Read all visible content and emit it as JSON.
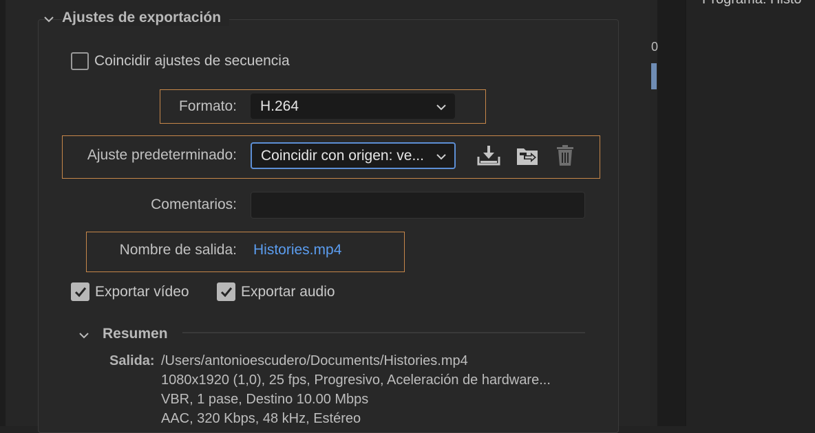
{
  "section": {
    "title": "Ajustes de exportación"
  },
  "match_sequence": {
    "label": "Coincidir ajustes de secuencia",
    "checked": false
  },
  "format": {
    "label": "Formato:",
    "value": "H.264"
  },
  "preset": {
    "label": "Ajuste predeterminado:",
    "value": "Coincidir con origen: ve..."
  },
  "preset_actions": [
    "save-preset-icon",
    "import-preset-icon",
    "delete-preset-icon"
  ],
  "comments": {
    "label": "Comentarios:",
    "value": ""
  },
  "output_name": {
    "label": "Nombre de salida:",
    "value": "Histories.mp4"
  },
  "export_video": {
    "label": "Exportar vídeo",
    "checked": true
  },
  "export_audio": {
    "label": "Exportar audio",
    "checked": true
  },
  "summary": {
    "title": "Resumen",
    "output_key": "Salida:",
    "lines": [
      "/Users/antonioescudero/Documents/Histories.mp4",
      "1080x1920 (1,0), 25 fps, Progresivo,  Aceleración de hardware...",
      "VBR, 1 pase, Destino 10.00 Mbps",
      "AAC, 320 Kbps, 48 kHz, Estéreo"
    ]
  },
  "side": {
    "zero": "0",
    "right_title": "Programa: Histo"
  },
  "colors": {
    "highlight": "#c8884a",
    "link": "#5b9df0",
    "focus": "#5d8fd6"
  }
}
